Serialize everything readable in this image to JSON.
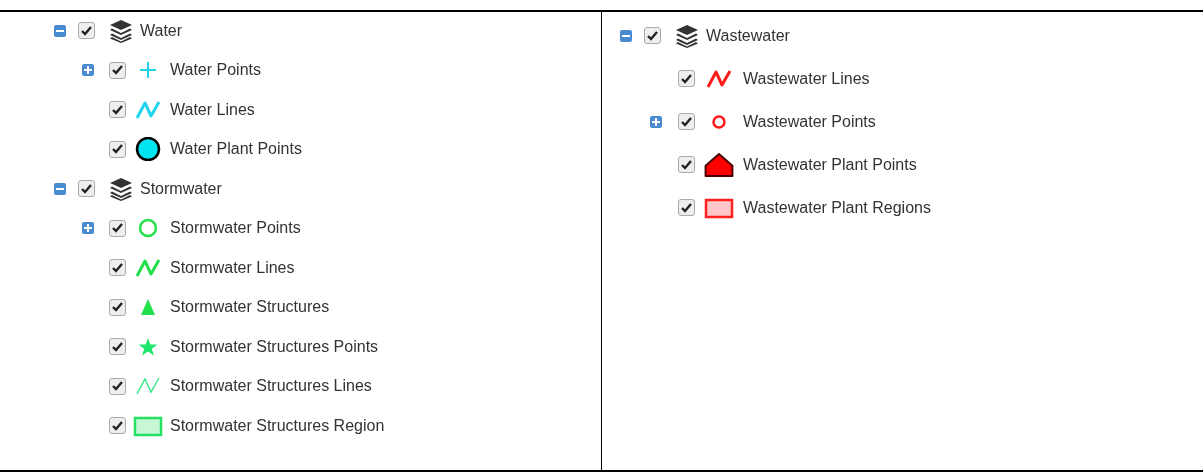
{
  "panels": [
    {
      "groups": [
        {
          "label": "Water",
          "expanded": true,
          "checked": true,
          "layers": [
            {
              "label": "Water Points",
              "checked": true,
              "expandable": true,
              "kind": "plus",
              "color": "#22d3ee"
            },
            {
              "label": "Water Lines",
              "checked": true,
              "expandable": false,
              "kind": "zigzag",
              "color": "#22d3ee"
            },
            {
              "label": "Water Plant Points",
              "checked": true,
              "expandable": false,
              "kind": "dot",
              "color": "#00e5f0"
            }
          ]
        },
        {
          "label": "Stormwater",
          "expanded": true,
          "checked": true,
          "layers": [
            {
              "label": "Stormwater Points",
              "checked": true,
              "expandable": true,
              "kind": "ring",
              "color": "#22e04a"
            },
            {
              "label": "Stormwater Lines",
              "checked": true,
              "expandable": false,
              "kind": "zigzag",
              "color": "#22e04a"
            },
            {
              "label": "Stormwater Structures",
              "checked": true,
              "expandable": false,
              "kind": "triangle",
              "color": "#1ee04a"
            },
            {
              "label": "Stormwater Structures Points",
              "checked": true,
              "expandable": false,
              "kind": "star",
              "color": "#1ee66a"
            },
            {
              "label": "Stormwater Structures Lines",
              "checked": true,
              "expandable": false,
              "kind": "zigzag-thin",
              "color": "#3ee68a"
            },
            {
              "label": "Stormwater Structures Region",
              "checked": true,
              "expandable": false,
              "kind": "rect",
              "color": "#22e060"
            }
          ]
        }
      ]
    },
    {
      "groups": [
        {
          "label": "Wastewater",
          "expanded": true,
          "checked": true,
          "layers": [
            {
              "label": "Wastewater Lines",
              "checked": true,
              "expandable": false,
              "kind": "zigzag",
              "color": "#ff1a1a"
            },
            {
              "label": "Wastewater Points",
              "checked": true,
              "expandable": true,
              "kind": "ring-small",
              "color": "#ff1a1a"
            },
            {
              "label": "Wastewater Plant Points",
              "checked": true,
              "expandable": false,
              "kind": "house",
              "color": "#ff0000"
            },
            {
              "label": "Wastewater Plant Regions",
              "checked": true,
              "expandable": false,
              "kind": "rect",
              "color": "#ff2020"
            }
          ]
        }
      ]
    }
  ]
}
